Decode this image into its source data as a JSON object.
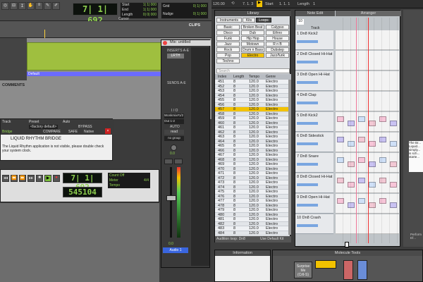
{
  "protools": {
    "counter_main": "7| 1| 692",
    "start_label": "Start",
    "start_val": "1| 1| 000",
    "end_label": "End",
    "end_val": "1| 1| 000",
    "length_label": "Length",
    "length_val": "0| 0| 000",
    "cursor_label": "Cursor",
    "grid_label": "Grid",
    "grid_val": "0| 1| 000",
    "nudge_label": "Nudge",
    "nudge_val": "0| 1| 000",
    "clips_label": "CLIPS",
    "comments_label": "COMMENTS",
    "default_label": "Default",
    "bridge_title": "LIQUID RHYTHM BRIDGE",
    "bridge_msg": "The Liquid Rhythm application is not visible, please double check your system clock.",
    "plugin_preset": "Preset",
    "plugin_auto": "Auto",
    "plugin_factory": "<factory default>",
    "plugin_bypass": "BYPASS",
    "plugin_compare": "COMPARE",
    "plugin_safe": "SAFE",
    "plugin_native": "Native",
    "plugin_track": "Track",
    "plugin_name": "Bridge",
    "trans_counter": "7| 1| 692",
    "trans_samples": "545104",
    "count_off": "Count Off",
    "meter": "Meter",
    "tempo": "Tempo",
    "meter_val": "4/4"
  },
  "mixer": {
    "title": "Mix: untitled",
    "inserts": "INSERTS A-E",
    "lrth": "LRTH",
    "sends": "SENDS A-E",
    "io": "I / O",
    "input": "Wonkmix#1/2",
    "output": "Out 1-2",
    "auto": "AUTO",
    "auto_mode": "read",
    "group": "no group",
    "vol": "0.0",
    "pan": "0.0",
    "track": "Audio 1"
  },
  "lr": {
    "top_left": "120.00",
    "position": "7. 1. 3",
    "start": "Start",
    "start_pos": "1. 1. 1",
    "length": "Length",
    "length_val": "1",
    "library_title": "Library",
    "tabs": [
      "Instruments",
      "Kits",
      "Loops"
    ],
    "genres": [
      "Basic",
      "Broken Beat",
      "Calypso",
      "Disco",
      "Dub",
      "Ethno",
      "Funk",
      "Hip Hop",
      "House",
      "Jazz",
      "Motown",
      "R n B",
      "Rock",
      "Drum n Bass",
      "Dubstep",
      "Pop",
      "Electro",
      "Jazz/funk",
      "Techno"
    ],
    "search": "Search",
    "columns": [
      "Index",
      "Length",
      "Tempo",
      "Genre"
    ],
    "rows": [
      [
        "451",
        "8",
        "120.0",
        "Electro"
      ],
      [
        "452",
        "8",
        "120.0",
        "Electro"
      ],
      [
        "453",
        "8",
        "120.0",
        "Electro"
      ],
      [
        "454",
        "8",
        "120.0",
        "Electro"
      ],
      [
        "455",
        "8",
        "120.0",
        "Electro"
      ],
      [
        "456",
        "8",
        "120.0",
        "Electro"
      ],
      [
        "457",
        "8",
        "120.0",
        "Electro"
      ],
      [
        "458",
        "8",
        "120.0",
        "Electro"
      ],
      [
        "459",
        "8",
        "120.0",
        "Electro"
      ],
      [
        "460",
        "8",
        "120.0",
        "Electro"
      ],
      [
        "461",
        "8",
        "120.0",
        "Electro"
      ],
      [
        "462",
        "8",
        "120.0",
        "Electro"
      ],
      [
        "463",
        "8",
        "120.0",
        "Electro"
      ],
      [
        "464",
        "8",
        "120.0",
        "Electro"
      ],
      [
        "465",
        "8",
        "120.0",
        "Electro"
      ],
      [
        "466",
        "8",
        "120.0",
        "Electro"
      ],
      [
        "467",
        "8",
        "120.0",
        "Electro"
      ],
      [
        "468",
        "8",
        "120.0",
        "Electro"
      ],
      [
        "469",
        "8",
        "120.0",
        "Electro"
      ],
      [
        "470",
        "8",
        "120.0",
        "Electro"
      ],
      [
        "471",
        "8",
        "120.0",
        "Electro"
      ],
      [
        "472",
        "8",
        "120.0",
        "Electro"
      ],
      [
        "473",
        "8",
        "120.0",
        "Electro"
      ],
      [
        "474",
        "8",
        "120.0",
        "Electro"
      ],
      [
        "475",
        "8",
        "120.0",
        "Electro"
      ],
      [
        "476",
        "8",
        "120.0",
        "Electro"
      ],
      [
        "477",
        "8",
        "120.0",
        "Electro"
      ],
      [
        "478",
        "8",
        "120.0",
        "Electro"
      ],
      [
        "479",
        "8",
        "120.0",
        "Electro"
      ],
      [
        "480",
        "8",
        "120.0",
        "Electro"
      ],
      [
        "481",
        "8",
        "120.0",
        "Electro"
      ],
      [
        "482",
        "8",
        "120.0",
        "Electro"
      ],
      [
        "483",
        "8",
        "120.0",
        "Electro"
      ],
      [
        "484",
        "8",
        "120.0",
        "Electro"
      ]
    ],
    "audition": "Audition loop: Dn8",
    "use_default": "Use Default Kit",
    "note_edit": "Note Edit",
    "arranger": "Arranger",
    "track_header": "Track",
    "track_count": "10",
    "tracks": [
      "1 Dn8 Kick2",
      "2 Dn8 Closed Hi-Hat",
      "3 Dn8 Open Hi-Hat",
      "4 Dn8 Clap",
      "5 Dn8 Kick2",
      "6 Dn8 Sidestick",
      "7 Dn8 Snare",
      "8 Dn8 Closed Hi-Hat",
      "9 Dn8 Open Hi-Hat",
      "10 Dn8 Crash"
    ],
    "information": "Information",
    "molecule_tools": "Molecule Tools",
    "surprise": "Surprise Me",
    "surprise2": "(Crtl-S)",
    "right_text": "The Br... Liquid... simply... is sch... starte...",
    "perform": "Perform Ef..."
  },
  "colors": {
    "accent_yellow": "#f2c200",
    "lcd_green": "#8fd14f",
    "clip_green": "#9fbf3f"
  }
}
